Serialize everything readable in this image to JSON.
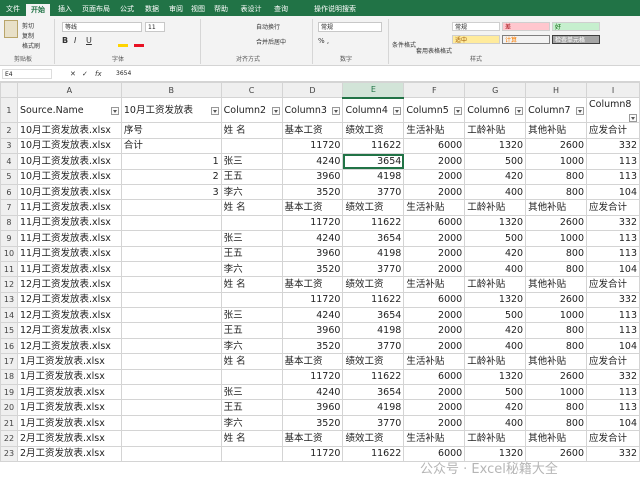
{
  "ribbon_tabs": [
    "文件",
    "开始",
    "插入",
    "页面布局",
    "公式",
    "数据",
    "审阅",
    "视图",
    "帮助",
    "表设计",
    "查询"
  ],
  "tell_me": "操作说明搜索",
  "clipboard": {
    "cut": "剪切",
    "copy": "复制",
    "painter": "格式刷",
    "group": "剪贴板"
  },
  "font": {
    "name": "等线",
    "size": "11",
    "group": "字体"
  },
  "alignment": {
    "wrap": "自动换行",
    "merge": "合并后居中",
    "group": "对齐方式"
  },
  "number": {
    "format": "常规",
    "group": "数字"
  },
  "styles": {
    "cond": "条件格式",
    "table": "套用表格格式",
    "normal": "常规",
    "bad": "差",
    "good": "好",
    "neutral": "适中",
    "calc": "计算",
    "check": "检查单元格",
    "group": "样式"
  },
  "name_box": "E4",
  "fx": "fx",
  "formula_value": "3654",
  "colors": {
    "excel_green": "#217346",
    "bad": "#ffc7ce",
    "good": "#c6efce",
    "neutral": "#ffeb9c",
    "calc": "#f2f2f2",
    "check": "#a5a5a5"
  },
  "col_letters": [
    "A",
    "B",
    "C",
    "D",
    "E",
    "F",
    "G",
    "H",
    "I"
  ],
  "rows": [
    {
      "n": "1",
      "c": [
        "Source.Name",
        "10月工资发放表",
        "Column2",
        "Column3",
        "Column4",
        "Column5",
        "Column6",
        "Column7",
        "Column8"
      ]
    },
    {
      "n": "2",
      "c": [
        "10月工资发放表.xlsx",
        "序号",
        "姓 名",
        "基本工资",
        "绩效工资",
        "生活补贴",
        "工龄补贴",
        "其他补贴",
        "应发合计"
      ]
    },
    {
      "n": "3",
      "c": [
        "10月工资发放表.xlsx",
        "合计",
        "",
        "11720",
        "11622",
        "6000",
        "1320",
        "2600",
        "332"
      ]
    },
    {
      "n": "4",
      "c": [
        "10月工资发放表.xlsx",
        "1",
        "张三",
        "4240",
        "3654",
        "2000",
        "500",
        "1000",
        "113"
      ]
    },
    {
      "n": "5",
      "c": [
        "10月工资发放表.xlsx",
        "2",
        "王五",
        "3960",
        "4198",
        "2000",
        "420",
        "800",
        "113"
      ]
    },
    {
      "n": "6",
      "c": [
        "10月工资发放表.xlsx",
        "3",
        "李六",
        "3520",
        "3770",
        "2000",
        "400",
        "800",
        "104"
      ]
    },
    {
      "n": "7",
      "c": [
        "11月工资发放表.xlsx",
        "",
        "姓 名",
        "基本工资",
        "绩效工资",
        "生活补贴",
        "工龄补贴",
        "其他补贴",
        "应发合计"
      ]
    },
    {
      "n": "8",
      "c": [
        "11月工资发放表.xlsx",
        "",
        "",
        "11720",
        "11622",
        "6000",
        "1320",
        "2600",
        "332"
      ]
    },
    {
      "n": "9",
      "c": [
        "11月工资发放表.xlsx",
        "",
        "张三",
        "4240",
        "3654",
        "2000",
        "500",
        "1000",
        "113"
      ]
    },
    {
      "n": "10",
      "c": [
        "11月工资发放表.xlsx",
        "",
        "王五",
        "3960",
        "4198",
        "2000",
        "420",
        "800",
        "113"
      ]
    },
    {
      "n": "11",
      "c": [
        "11月工资发放表.xlsx",
        "",
        "李六",
        "3520",
        "3770",
        "2000",
        "400",
        "800",
        "104"
      ]
    },
    {
      "n": "12",
      "c": [
        "12月工资发放表.xlsx",
        "",
        "姓 名",
        "基本工资",
        "绩效工资",
        "生活补贴",
        "工龄补贴",
        "其他补贴",
        "应发合计"
      ]
    },
    {
      "n": "13",
      "c": [
        "12月工资发放表.xlsx",
        "",
        "",
        "11720",
        "11622",
        "6000",
        "1320",
        "2600",
        "332"
      ]
    },
    {
      "n": "14",
      "c": [
        "12月工资发放表.xlsx",
        "",
        "张三",
        "4240",
        "3654",
        "2000",
        "500",
        "1000",
        "113"
      ]
    },
    {
      "n": "15",
      "c": [
        "12月工资发放表.xlsx",
        "",
        "王五",
        "3960",
        "4198",
        "2000",
        "420",
        "800",
        "113"
      ]
    },
    {
      "n": "16",
      "c": [
        "12月工资发放表.xlsx",
        "",
        "李六",
        "3520",
        "3770",
        "2000",
        "400",
        "800",
        "104"
      ]
    },
    {
      "n": "17",
      "c": [
        "1月工资发放表.xlsx",
        "",
        "姓 名",
        "基本工资",
        "绩效工资",
        "生活补贴",
        "工龄补贴",
        "其他补贴",
        "应发合计"
      ]
    },
    {
      "n": "18",
      "c": [
        "1月工资发放表.xlsx",
        "",
        "",
        "11720",
        "11622",
        "6000",
        "1320",
        "2600",
        "332"
      ]
    },
    {
      "n": "19",
      "c": [
        "1月工资发放表.xlsx",
        "",
        "张三",
        "4240",
        "3654",
        "2000",
        "500",
        "1000",
        "113"
      ]
    },
    {
      "n": "20",
      "c": [
        "1月工资发放表.xlsx",
        "",
        "王五",
        "3960",
        "4198",
        "2000",
        "420",
        "800",
        "113"
      ]
    },
    {
      "n": "21",
      "c": [
        "1月工资发放表.xlsx",
        "",
        "李六",
        "3520",
        "3770",
        "2000",
        "400",
        "800",
        "104"
      ]
    },
    {
      "n": "22",
      "c": [
        "2月工资发放表.xlsx",
        "",
        "姓 名",
        "基本工资",
        "绩效工资",
        "生活补贴",
        "工龄补贴",
        "其他补贴",
        "应发合计"
      ]
    },
    {
      "n": "23",
      "c": [
        "2月工资发放表.xlsx",
        "",
        "",
        "11720",
        "11622",
        "6000",
        "1320",
        "2600",
        "332"
      ]
    }
  ],
  "watermark": "公众号 · Excel秘籍大全"
}
